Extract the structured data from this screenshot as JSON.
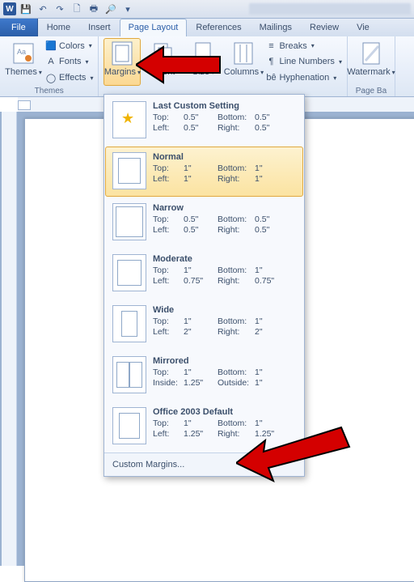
{
  "qat": {
    "save": "💾",
    "undo": "↶",
    "redo": "↷",
    "q4": "🗋",
    "q5": "🖶",
    "q6": "🔎",
    "q7": "▾"
  },
  "tabs": {
    "file": "File",
    "home": "Home",
    "insert": "Insert",
    "page_layout": "Page Layout",
    "references": "References",
    "mailings": "Mailings",
    "review": "Review",
    "view": "Vie"
  },
  "ribbon": {
    "themes": {
      "label": "Themes",
      "themes_btn": "Themes",
      "colors": "Colors",
      "fonts": "Fonts",
      "effects": "Effects"
    },
    "page_setup": {
      "margins": "Margins",
      "orientation": "Orientation",
      "size": "Size",
      "columns": "Columns",
      "breaks": "Breaks",
      "line_numbers": "Line Numbers",
      "hyphenation": "Hyphenation"
    },
    "page_bg": {
      "label": "Page Ba",
      "watermark": "Watermark"
    }
  },
  "menu": {
    "last": {
      "title": "Last Custom Setting",
      "top_l": "Top:",
      "top_v": "0.5\"",
      "bot_l": "Bottom:",
      "bot_v": "0.5\"",
      "left_l": "Left:",
      "left_v": "0.5\"",
      "right_l": "Right:",
      "right_v": "0.5\""
    },
    "normal": {
      "title": "Normal",
      "top_l": "Top:",
      "top_v": "1\"",
      "bot_l": "Bottom:",
      "bot_v": "1\"",
      "left_l": "Left:",
      "left_v": "1\"",
      "right_l": "Right:",
      "right_v": "1\""
    },
    "narrow": {
      "title": "Narrow",
      "top_l": "Top:",
      "top_v": "0.5\"",
      "bot_l": "Bottom:",
      "bot_v": "0.5\"",
      "left_l": "Left:",
      "left_v": "0.5\"",
      "right_l": "Right:",
      "right_v": "0.5\""
    },
    "moderate": {
      "title": "Moderate",
      "top_l": "Top:",
      "top_v": "1\"",
      "bot_l": "Bottom:",
      "bot_v": "1\"",
      "left_l": "Left:",
      "left_v": "0.75\"",
      "right_l": "Right:",
      "right_v": "0.75\""
    },
    "wide": {
      "title": "Wide",
      "top_l": "Top:",
      "top_v": "1\"",
      "bot_l": "Bottom:",
      "bot_v": "1\"",
      "left_l": "Left:",
      "left_v": "2\"",
      "right_l": "Right:",
      "right_v": "2\""
    },
    "mirrored": {
      "title": "Mirrored",
      "top_l": "Top:",
      "top_v": "1\"",
      "bot_l": "Bottom:",
      "bot_v": "1\"",
      "left_l": "Inside:",
      "left_v": "1.25\"",
      "right_l": "Outside:",
      "right_v": "1\""
    },
    "o2003": {
      "title": "Office 2003 Default",
      "top_l": "Top:",
      "top_v": "1\"",
      "bot_l": "Bottom:",
      "bot_v": "1\"",
      "left_l": "Left:",
      "left_v": "1.25\"",
      "right_l": "Right:",
      "right_v": "1.25\""
    },
    "custom": "Custom Margins..."
  }
}
